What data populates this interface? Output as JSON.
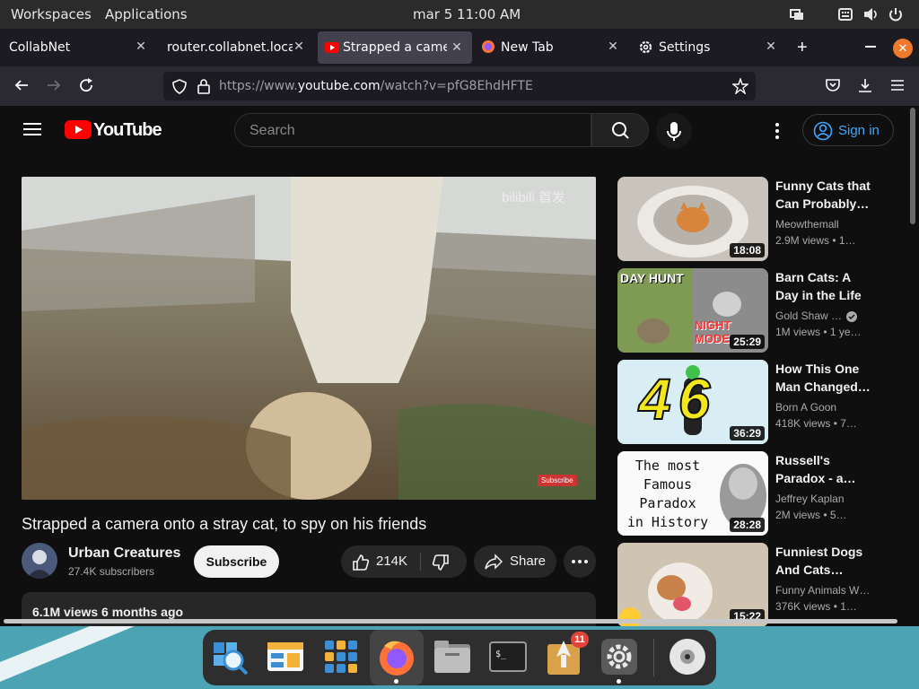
{
  "system": {
    "workspaces": "Workspaces",
    "applications": "Applications",
    "clock": "mar 5  11:00 AM"
  },
  "tabs": [
    {
      "label": "CollabNet",
      "active": false
    },
    {
      "label": "router.collabnet.local/",
      "active": false
    },
    {
      "label": "Strapped a camera",
      "active": true
    },
    {
      "label": "New Tab",
      "active": false
    },
    {
      "label": "Settings",
      "active": false
    }
  ],
  "address": {
    "prefix": "https://www.",
    "host": "youtube.com",
    "path": "/watch?v=pfG8EhdHFTE"
  },
  "youtube": {
    "logo": "YouTube",
    "search_placeholder": "Search",
    "sign_in": "Sign in",
    "video_title": "Strapped a camera onto a stray cat, to spy on his friends",
    "channel": "Urban Creatures",
    "subscribers": "27.4K subscribers",
    "subscribe": "Subscribe",
    "likes": "214K",
    "share": "Share",
    "views": "6.1M views  6 months ago",
    "watermark": "bilibili 首发",
    "subscribe_badge": "Subscribe",
    "recommendations": [
      {
        "title": "Funny Cats that Can Probably…",
        "channel": "Meowthemall",
        "meta": "2.9M views  • 1…",
        "duration": "18:08",
        "verified": false
      },
      {
        "title": "Barn Cats: A Day in the Life",
        "channel": "Gold Shaw …",
        "meta": "1M views  • 1 ye…",
        "duration": "25:29",
        "verified": true,
        "thumb_text": [
          "DAY HUNT",
          "NIGHT MODE"
        ]
      },
      {
        "title": "How This One Man Changed…",
        "channel": "Born A Goon",
        "meta": "418K views  • 7…",
        "duration": "36:29",
        "verified": false,
        "thumb_text": [
          "46"
        ]
      },
      {
        "title": "Russell's Paradox - a…",
        "channel": "Jeffrey Kaplan",
        "meta": "2M views  • 5…",
        "duration": "28:28",
        "verified": false,
        "thumb_text": [
          "The most",
          "Famous",
          "Paradox",
          "in History"
        ]
      },
      {
        "title": "Funniest Dogs And Cats…",
        "channel": "Funny Animals W…",
        "meta": "376K views  • 1…",
        "duration": "15:22",
        "verified": false
      }
    ]
  },
  "dock": {
    "badge_count": "11",
    "apps": [
      "magnifier-icon",
      "file-manager-icon",
      "app-grid-icon",
      "firefox-icon",
      "files-icon",
      "terminal-icon",
      "launcher-icon",
      "settings-icon",
      "disc-icon"
    ]
  },
  "colors": {
    "yt_red": "#ff0000",
    "link_blue": "#3ea6ff",
    "dock_bg": "#2e2e2e",
    "desktop_teal": "#4ba3b3"
  }
}
